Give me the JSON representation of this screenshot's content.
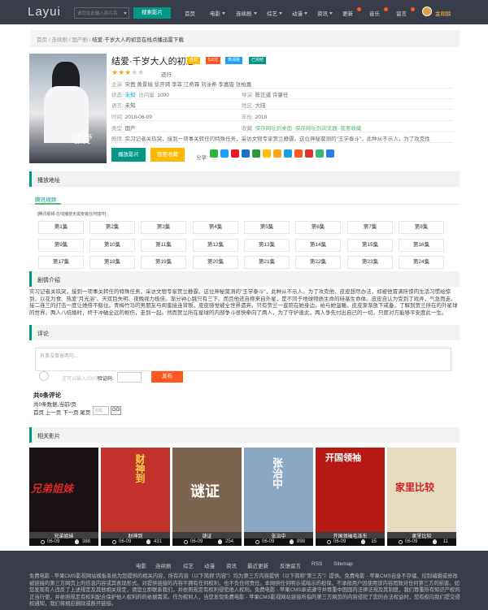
{
  "header": {
    "logo": "Layui",
    "search_placeholder": "请您在此输入影片名",
    "search_button": "搜索影片",
    "nav": [
      {
        "label": "首页"
      },
      {
        "label": "电影"
      },
      {
        "label": "连续剧"
      },
      {
        "label": "综艺"
      },
      {
        "label": "动漫"
      },
      {
        "label": "资讯"
      },
      {
        "label": "更新"
      },
      {
        "label": "音乐"
      },
      {
        "label": "留言"
      }
    ],
    "username": "金刚狼"
  },
  "breadcrumb": {
    "items": [
      "首页",
      "连续剧",
      "国产剧"
    ],
    "current": "结爱·千岁大人的初恋在线点播迅雷下载"
  },
  "movie": {
    "title": "结爱·千岁大人的初恋",
    "tags": [
      "连载",
      "5.6分",
      "高清版",
      "已完结"
    ],
    "rating_label": "还行",
    "rating_stars": 3,
    "rating_max": 5,
    "cast_label": "主演:",
    "cast": "宋茜 黄景瑜 徐开骋 李菲 江奇霖 刘泳希 李嘉璇 张柏嘉",
    "status_label": "状态:",
    "status": "未知",
    "visits_label": "访问量:",
    "visits": "1000",
    "director_label": "导演:",
    "director": "陈正道 许肇任",
    "language_label": "语言:",
    "language": "未知",
    "region_label": "地区:",
    "region": "大陆",
    "date_label": "时间:",
    "date": "2018-06-09",
    "year_label": "年份:",
    "year": "2018",
    "type_label": "类型:",
    "type": "国产",
    "collect_label": "收藏:",
    "collect_links": [
      "保存网址到桌面",
      "保存网址到浏览器",
      "我要收藏"
    ],
    "synopsis_label": "剧情:",
    "synopsis": "实习记者关玖突，接到一项事关转任的特殊任务，采访文物专家贺兰静霆。这位神秘莫测的\"玉学泰斗\"，此种从不示人，为了攻克性",
    "play_button": "播放影片",
    "fav_button": "我要收藏",
    "share_label": "分享:"
  },
  "colors": {
    "topbar": "#393d49",
    "accent": "#009688",
    "orange": "#ff5722",
    "yellow": "#ffb800",
    "blue": "#1e9fff",
    "link": "#01aaed",
    "green": "#5fb878"
  },
  "share_icons": [
    "wechat-icon",
    "qq-icon",
    "weibo-icon",
    "renren-icon",
    "douban-icon",
    "qzone-icon",
    "star-icon",
    "pinterest-icon",
    "baidu-icon",
    "sina-icon",
    "clover-icon",
    "plus-icon"
  ],
  "playlist": {
    "section_title": "播放地址",
    "tab": "腾讯视频",
    "tip": "[腾讯视频-在线播放无需安装任何插件]",
    "episodes": [
      "第1集",
      "第2集",
      "第3集",
      "第4集",
      "第5集",
      "第6集",
      "第7集",
      "第8集",
      "第9集",
      "第10集",
      "第11集",
      "第12集",
      "第13集",
      "第14集",
      "第15集",
      "第16集",
      "第17集",
      "第18集",
      "第19集",
      "第20集",
      "第21集",
      "第22集",
      "第23集",
      "第24集"
    ]
  },
  "intro": {
    "section_title": "剧情介绍",
    "text": "实习记者关玖突，接到一项事关转任的特殊任务，采访文物专家贺兰静霆。这位神秘莫测的\"玉学泰斗\"，此种从不示人。为了攻克他，皮皮想尽办法，却被他冒满所惊的生活习惯给惊到，以花为食、热爱\"月光浴\"、天双目失明、夜晚视力极佳。渐分钟心跳只有三下。而且他还自称来自外星，是不同于地球物质生命的硅基生命体。皮皮自认为受到了戏弄，气急而走。接二连三的打击一度让她倍不稳住。青梅竹马的男朋友与闺蜜接连背叛，皮皮感觉被全世界遗弃。只有贺兰一直陪在她身边，给与她温暖。皮皮渐渐放下戒备，了解到贺兰所在的外星球的世界，两人八结婚时，终于冲破全远的枢伤，走到一起。然而贺兰所在星球的内部争斗很快牵向了两人，为了守护彼此，两人争先付出自己的一切，只愿对方能够平安度此一生。"
  },
  "comment": {
    "section_title": "评论",
    "placeholder": "有事没事留两句...",
    "verify_hint": "还可以输入200字",
    "verify_label": "验证码:",
    "submit": "发布",
    "total": "共0条评论",
    "stats": "共0条数据,当前/页",
    "pager": "首页 上一页 下一页 尾页",
    "page_placeholder": "页码",
    "go": "GO"
  },
  "related": {
    "section_title": "相关影片",
    "items": [
      {
        "name": "兄弟姐妹",
        "date": "06-09",
        "views": "388",
        "poster_text": "兄弟姐妹",
        "bg": "#1a1214"
      },
      {
        "name": "财神到",
        "date": "06-09",
        "views": "431",
        "poster_text": "财神到",
        "bg": "#c3322a"
      },
      {
        "name": "谜证",
        "date": "06-09",
        "views": "254",
        "poster_text": "谜证",
        "bg": "#7c6550"
      },
      {
        "name": "张治中",
        "date": "06-09",
        "views": "898",
        "poster_text": "张治中",
        "bg": "#8ba8c2"
      },
      {
        "name": "开国领袖毛泽东",
        "date": "06-09",
        "views": "15",
        "poster_text": "开国领袖",
        "bg": "#b51a14"
      },
      {
        "name": "家里比较",
        "date": "06-09",
        "views": "11",
        "poster_text": "家里比较",
        "bg": "#e8dcc0"
      }
    ]
  },
  "footer": {
    "links": [
      "电影",
      "连续剧",
      "综艺",
      "动漫",
      "资讯",
      "最近更新",
      "反馈留言",
      "RSS",
      "Sitemap"
    ],
    "text": "免费电影 - 苹果CMS影视网站模板系统为您提供的相关内容，所有内容（以下简称\"内容\"）均为第三方内容提供（以下简称\"第三方\"）提供。免费电影 - 苹果CMS自身不存储、控制编辑或修改被链接的第三方网页上的信息内容或其表现形式。对提供链接的内容不拥有任何权利，也不负任何责任。本网供任何明示或暗示的担保，不承担用户因使用该内容而致对任何第三方的损害。如您发现有人违反了上述规定及其他相关规定，请您立即联系我们，并依照规定有权利侵犯他人权利。免费电影 - 苹果CMS承诺遵守并尊重中国国内法律法规及其制度，我们尊重所有知识产权的正当行使，并依照规定有权利配合保护他人权利的的依据需求。作为权利人，当您发现免费电影 - 苹果CMS影视网站链接所指的第三方网页的内容侵犯了您的合法权益时，您有权向我们提交侵权通知，我们将相应删除或断开链接。"
  }
}
